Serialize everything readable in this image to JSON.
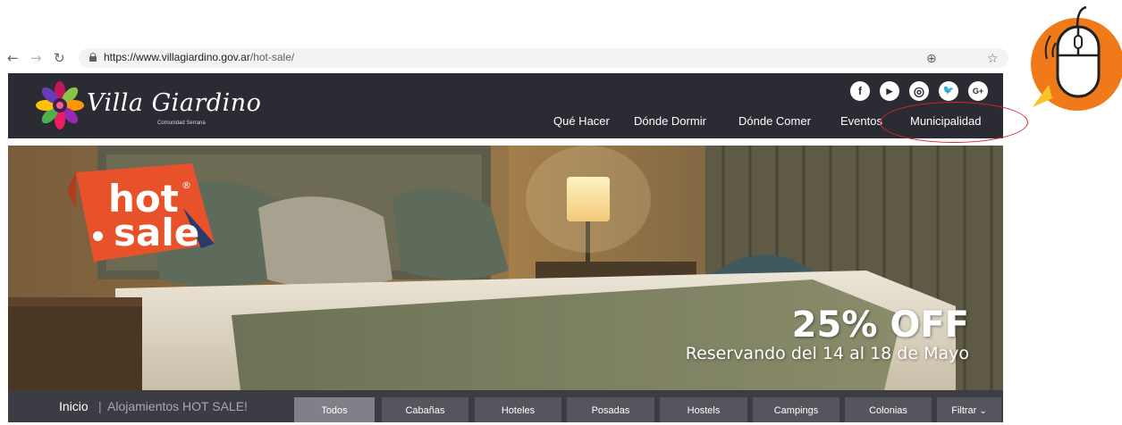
{
  "browser": {
    "back_icon": "back-arrow-icon",
    "forward_icon": "forward-arrow-icon",
    "reload_icon": "reload-icon",
    "url_host": "https://www.villagiardino.gov.ar",
    "url_path": "/hot-sale/",
    "zoom_icon": "zoom-icon",
    "star_icon": "bookmark-star-icon"
  },
  "header": {
    "logo_title": "Villa Giardino",
    "logo_subtitle": "Comunidad Serrana",
    "social": [
      {
        "name": "facebook-icon",
        "glyph": "f"
      },
      {
        "name": "youtube-icon",
        "glyph": "▶"
      },
      {
        "name": "instagram-icon",
        "glyph": "◎"
      },
      {
        "name": "twitter-icon",
        "glyph": "🐦"
      },
      {
        "name": "google-plus-icon",
        "glyph": "G+"
      }
    ],
    "menu": [
      "Qué Hacer",
      "Dónde Dormir",
      "Dónde Comer",
      "Eventos",
      "Municipalidad"
    ]
  },
  "hero": {
    "badge_line1": "hot",
    "badge_line2": "sale",
    "badge_mark": "®",
    "off_text": "25% OFF",
    "dates_text": "Reservando del 14 al 18 de Mayo"
  },
  "breadcrumb": {
    "home": "Inicio",
    "separator": "|",
    "current": "Alojamientos HOT SALE!"
  },
  "filters": {
    "tabs": [
      "Todos",
      "Cabañas",
      "Hoteles",
      "Posadas",
      "Hostels",
      "Campings",
      "Colonias",
      "Filtrar"
    ],
    "active": "Todos"
  },
  "colors": {
    "header_bg": "#2a2b33",
    "filter_bg": "#3c3d44",
    "badge_orange": "#e8522a",
    "annotation_red": "#d9262e",
    "mouse_badge_orange": "#f07a1a"
  }
}
